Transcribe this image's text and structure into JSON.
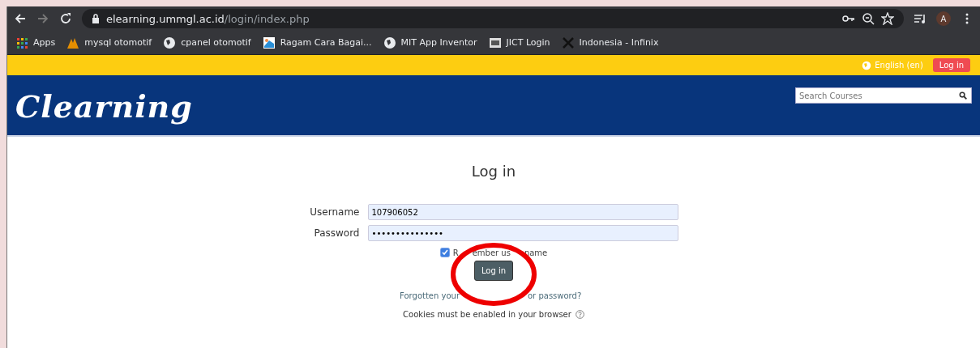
{
  "browser": {
    "url_host": "elearning.ummgl.ac.id",
    "url_path": "/login/index.php",
    "profile_initial": "A",
    "bookmarks": [
      {
        "label": "Apps",
        "kind": "apps"
      },
      {
        "label": "mysql otomotif",
        "kind": "logo"
      },
      {
        "label": "cpanel otomotif",
        "kind": "globe"
      },
      {
        "label": "Ragam Cara Bagai...",
        "kind": "image"
      },
      {
        "label": "MIT App Inventor",
        "kind": "globe"
      },
      {
        "label": "JICT Login",
        "kind": "box"
      },
      {
        "label": "Indonesia - Infinix",
        "kind": "x"
      }
    ]
  },
  "topbar": {
    "language": "English (en)",
    "login_button": "Log in"
  },
  "header": {
    "logo": "Clearning",
    "search": {
      "placeholder": "Search Courses"
    }
  },
  "login": {
    "title": "Log in",
    "fields": [
      {
        "label": "Username",
        "value": "107906052"
      },
      {
        "label": "Password",
        "value": "•••••••••••••••"
      }
    ],
    "remember": {
      "label_parts": [
        "R",
        "ember us",
        "name"
      ],
      "checked": true
    },
    "submit": "Log in",
    "forgot_link_parts": [
      "Forgotten your",
      "or password?"
    ],
    "cookies_note": "Cookies must be enabled in your browser"
  },
  "annotation": {
    "kind": "circle"
  }
}
